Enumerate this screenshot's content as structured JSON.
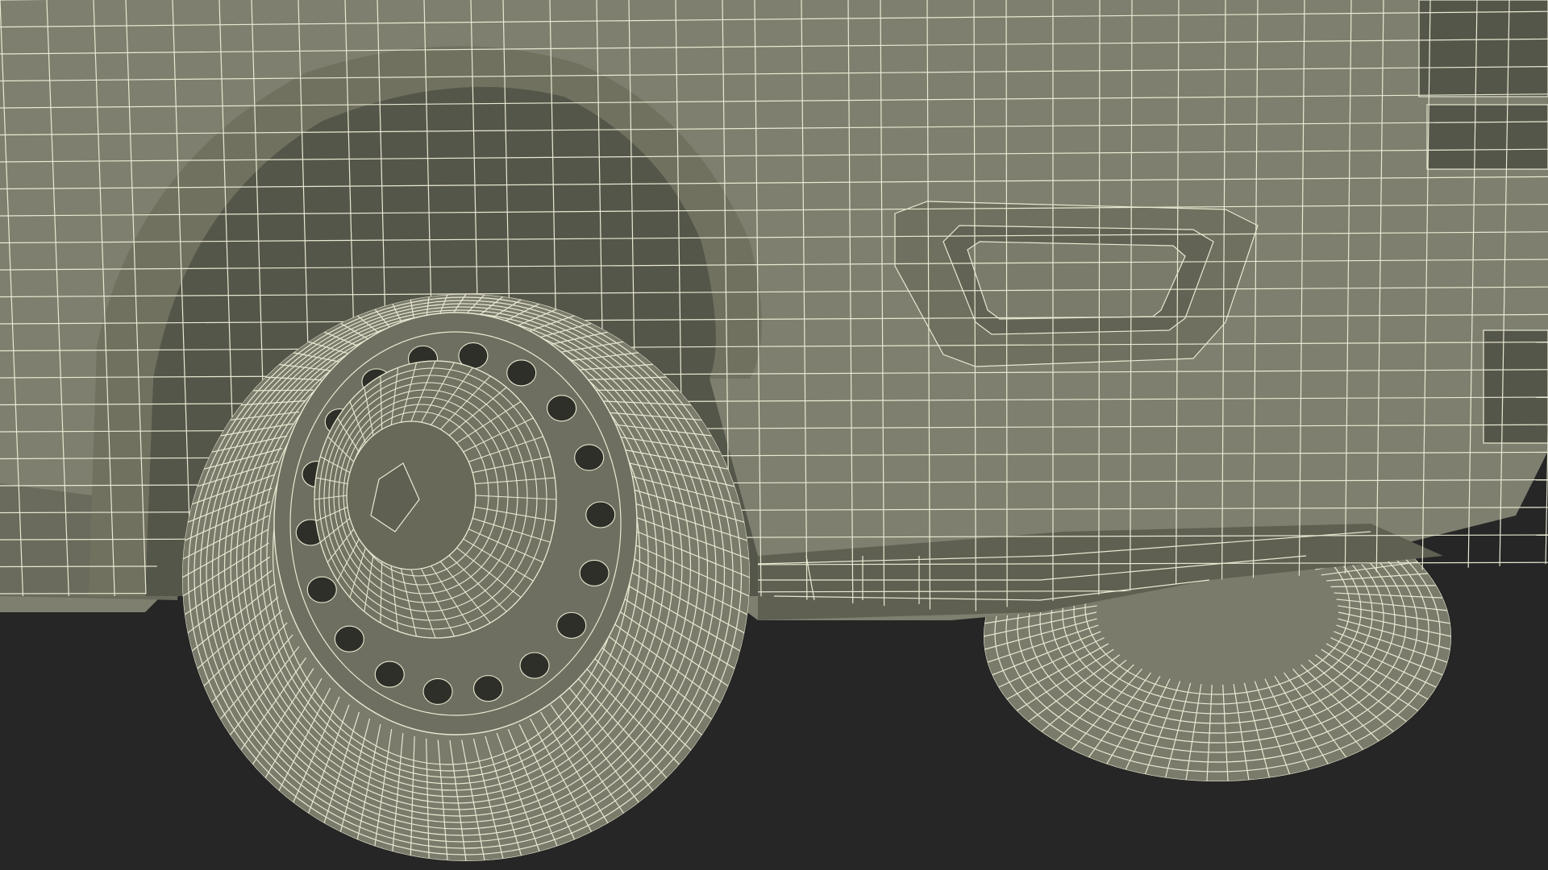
{
  "scene": {
    "subject": "car-front-wheel-wireframe",
    "colors": {
      "background": "#262626",
      "body": "#7e7f6e",
      "body_dark": "#5f6052",
      "body_shadow": "#4a4b40",
      "wheel_well": "#55564a",
      "tire": "#7a7b6b",
      "rim": "#6e6f60",
      "rim_hole": "#2e2f28",
      "wire": "#e9e8d2"
    }
  }
}
